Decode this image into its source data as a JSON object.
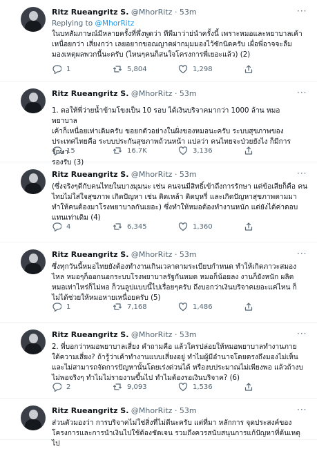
{
  "reply_prefix": "Replying to",
  "reply_handle": "@MhorRitz",
  "tweets": [
    {
      "name": "Ritz Rueangritz S.",
      "handle": "@MhorRitz",
      "time": "· 53m",
      "text": "ในบทสัมภาษณ์มีหลายครั้งที่พึ่งพูดว่า ทีพีมาว่าย่นำครั้งนี้ เพราะหมอและพยาบาลเค้า\nเหนื่อยกว่า เสี่ยงกว่า เลยอยากขอณญาตฝากมุมมองไว้ซักนิดครับ เผื่อพี่อาจจะลืม\nมองเหตุผลพวกนี้นะครับ (ไหนๆคนก็สนใจโครงการพี่เยอะแล้ว) (2)",
      "replies": "1",
      "retweets": "5,804",
      "likes": "1,298"
    },
    {
      "name": "Ritz Rueangritz S.",
      "handle": "@MhorRitz",
      "time": "· 53m",
      "text": "1. ตอให้พี่ว่ายน้ำข้ามโขงเป็น 10 รอบ ได้เงินบริจาคมากว่า 1000 ล้าน หมอ พยาบาล\nเค้าก็เหนื่อยเท่าเดิมครับ ขอยกตัวอย่างในฝั่งของหมอนะครับ ระบบสุขภาพของ\nประเทศไทยคือ ระบบประกันสุขภาพถ้วนหน้า แปลว่า คนไทยจะป่วยยังไง ก็มีการรักษา\nรองรับ (3)",
      "replies": "15",
      "retweets": "16.7K",
      "likes": "3,136"
    },
    {
      "name": "Ritz Rueangritz S.",
      "handle": "@MhorRitz",
      "time": "· 53m",
      "text": "(ซึ่งจริงๆดีกับคนไทยในบางมุมนะ เช่น คนจนมีสิทธิ์เข้าถึงการรักษา แต่ข้อเสียก็คือ คน\nไทยไม่ใส่ใจสุขภาพ เกิดปัญหา เช่น ติดเหล้า ติดบุหรี่ และเกิดปัญหาสุขภาพตามมา\nทำให้คนต้องมาโรงพยาบาลกันเยอะ) ซึ่งทำให้หมอต้องทำงานหนัก แต่ยังได้ค่าตอบ\nแทนเท่าเดิม (4)",
      "replies": "4",
      "retweets": "6,345",
      "likes": "1,360"
    },
    {
      "name": "Ritz Rueangritz S.",
      "handle": "@MhorRitz",
      "time": "· 53m",
      "text": "ซึ่งทุกวันนี้หมอไทยยังต้องทำงานเกินเวลาตามระเบียบกำหนด ทำให้เกิดภาวะสมอง\nไหล หมอๆก็ออกนอกระบบโรงพยาบาลรัฐกันหมด หมอก็น้อยลง งานก็ยังหนัก ผลิต\nหมอเท่าไหร่ก็ไม่พอ ก็วนลูปแบบนี้ไปเรื่อยๆครับ ถึงบอกว่าเงินบริจาคเยอะแค่ไหน ก็\nไม่ได้ช่วยให้หมอหายเหนื่อยครับ (5)",
      "replies": "1",
      "retweets": "7,168",
      "likes": "1,486"
    },
    {
      "name": "Ritz Rueangritz S.",
      "handle": "@MhorRitz",
      "time": "· 53m",
      "text": "2. พี่บอกว่าหมอพยาบาลเสี่ยง คำถามคือ แล้วใครปล่อยให้หมอพยาบาลทำงานภาย\nใต้ความเสี่ยง? ถ้ารู้ว่าเค้าทำงานแบบเสี่ยงอยู่ ทำไมผู้มีอำนาจโดยตรงถึงมองไม่เห็น\nและไม่สามารถจัดการปัญหานั้นโดยเร่งด่วนได้ หรืองบประมาณไม่เพียงพอ แล้วถ้างบ\nไม่พอจริงๆ ทำไมไม่รายงานขึ้นไป ทำไมต้องรอเงินบริจาค? (6)",
      "replies": "2",
      "retweets": "9,093",
      "likes": "1,536"
    },
    {
      "name": "Ritz Rueangritz S.",
      "handle": "@MhorRitz",
      "time": "· 53m",
      "text": "ส่วนตัวมองว่า การบริจาคไม่ใช่สิ่งที่ไม่ดีนะครับ แต่ที่มา หลักการ จุดประสงค์ของ\nโครงการและการนำเงินไปใช้ต้องชัดเจน รวมถึงควรสนับสนุนการแก้ปัญหาที่ต้นเหตุไป",
      "replies": "",
      "retweets": "",
      "likes": ""
    }
  ]
}
